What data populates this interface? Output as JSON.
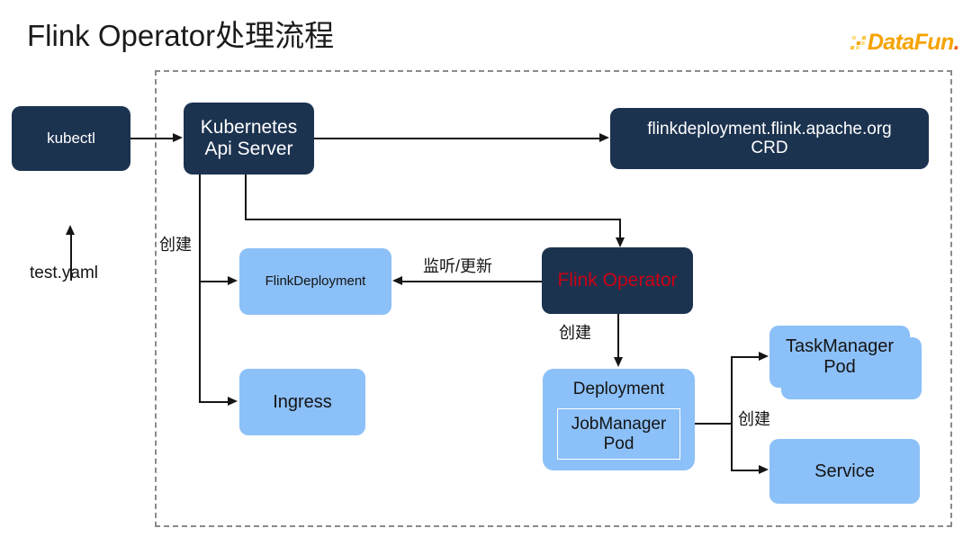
{
  "slide": {
    "title": "Flink Operator处理流程",
    "background": "#ffffff"
  },
  "logo": {
    "name": "datafun-logo",
    "text_primary": "DataFun",
    "text_suffix": ".",
    "color_primary": "#F5A300",
    "color_suffix": "#F25C12"
  },
  "diagram": {
    "type": "flowchart",
    "colors": {
      "node_dark": "#1C3350",
      "node_light": "#8CC0F8",
      "accent_red": "#CC0014",
      "edge": "#151515",
      "boundary_dashed": "#8b8b8b"
    },
    "boundary_label": "",
    "nodes": {
      "kubectl": "kubectl",
      "api_server": "Kubernetes\nApi Server",
      "crd": "flinkdeployment.flink.apache.org\nCRD",
      "flink_deployment": "FlinkDeployment",
      "flink_operator": "Flink Operator",
      "ingress": "Ingress",
      "deployment": "Deployment",
      "jobmanager_pod": "JobManager\nPod",
      "taskmanager_pod": "TaskManager\nPod",
      "service": "Service"
    },
    "labels": {
      "test_yaml": "test.yaml",
      "create_left": "创建",
      "watch_update": "监听/更新",
      "create_operator": "创建",
      "create_pods": "创建"
    },
    "edges": [
      {
        "from": "test.yaml",
        "to": "kubectl",
        "label": ""
      },
      {
        "from": "kubectl",
        "to": "Kubernetes Api Server",
        "label": ""
      },
      {
        "from": "Kubernetes Api Server",
        "to": "flinkdeployment.flink.apache.org CRD",
        "label": ""
      },
      {
        "from": "Kubernetes Api Server",
        "to": "Flink Operator",
        "label": ""
      },
      {
        "from": "Kubernetes Api Server",
        "to": "FlinkDeployment",
        "label": "创建"
      },
      {
        "from": "Kubernetes Api Server",
        "to": "Ingress",
        "label": "创建"
      },
      {
        "from": "Flink Operator",
        "to": "FlinkDeployment",
        "label": "监听/更新"
      },
      {
        "from": "Flink Operator",
        "to": "Deployment",
        "label": "创建"
      },
      {
        "from": "JobManager Pod",
        "to": "TaskManager Pod",
        "label": "创建"
      },
      {
        "from": "JobManager Pod",
        "to": "Service",
        "label": "创建"
      }
    ]
  }
}
